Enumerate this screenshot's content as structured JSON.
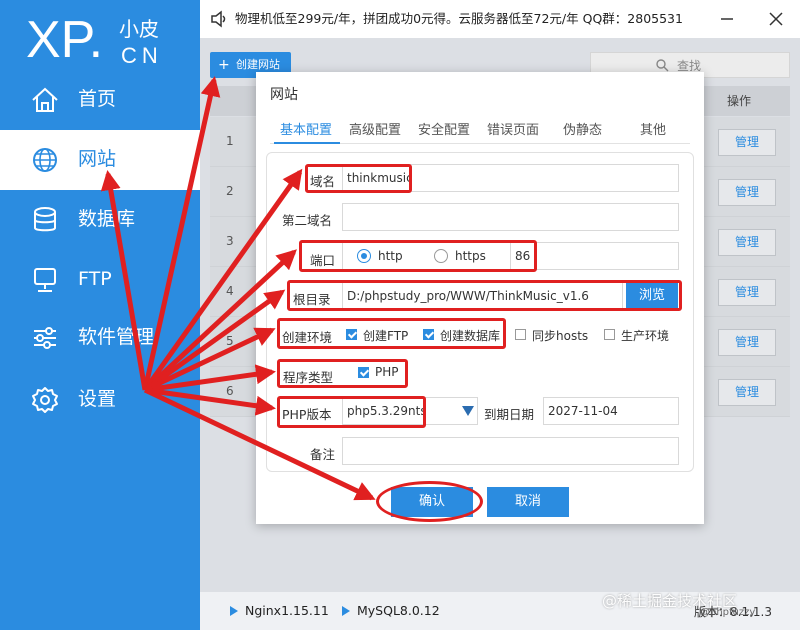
{
  "logo": {
    "xp": "XP.",
    "small": "小皮",
    "cn": "CN"
  },
  "sidebar": {
    "items": [
      {
        "label": "首页",
        "icon": "home-icon",
        "active": false
      },
      {
        "label": "网站",
        "icon": "globe-icon",
        "active": true
      },
      {
        "label": "数据库",
        "icon": "database-icon",
        "active": false
      },
      {
        "label": "FTP",
        "icon": "monitor-icon",
        "active": false
      },
      {
        "label": "软件管理",
        "icon": "sliders-icon",
        "active": false
      },
      {
        "label": "设置",
        "icon": "gear-icon",
        "active": false
      }
    ]
  },
  "topbar": {
    "notice": "物理机低至299元/年，拼团成功0元得。云服务器低至72元/年 QQ群：2805531"
  },
  "main": {
    "create_label": "创建网站",
    "search_label": "查找",
    "op_header": "操作",
    "rows": [
      {
        "num": "1",
        "action": "管理"
      },
      {
        "num": "2",
        "action": "管理"
      },
      {
        "num": "3",
        "action": "管理"
      },
      {
        "num": "4",
        "action": "管理"
      },
      {
        "num": "5",
        "action": "管理"
      },
      {
        "num": "6",
        "action": "管理"
      }
    ]
  },
  "status": {
    "nginx": "Nginx1.15.11",
    "mysql": "MySQL8.0.12",
    "version": "版本：8.1.1.3"
  },
  "watermark": {
    "main": "@稀土掘金技术社区",
    "sub": "@phpfuzzy"
  },
  "modal": {
    "title": "网站",
    "tabs": [
      "基本配置",
      "高级配置",
      "安全配置",
      "错误页面",
      "伪静态",
      "其他"
    ],
    "domain_label": "域名",
    "domain_value": "thinkmusic",
    "second_domain_label": "第二域名",
    "second_domain_value": "",
    "port_label": "端口",
    "port_http": "http",
    "port_https": "https",
    "port_value": "86",
    "root_label": "根目录",
    "root_value": "D:/phpstudy_pro/WWW/ThinkMusic_v1.6",
    "browse_label": "浏览",
    "env_label": "创建环境",
    "env_ftp": "创建FTP",
    "env_db": "创建数据库",
    "env_hosts": "同步hosts",
    "env_prod": "生产环境",
    "prog_label": "程序类型",
    "prog_php": "PHP",
    "php_label": "PHP版本",
    "php_value": "php5.3.29nts",
    "expire_label": "到期日期",
    "expire_value": "2027-11-04",
    "remark_label": "备注",
    "remark_value": "",
    "confirm_label": "确认",
    "cancel_label": "取消"
  },
  "colors": {
    "accent": "#2b8ce0",
    "annotation": "#e02020"
  }
}
